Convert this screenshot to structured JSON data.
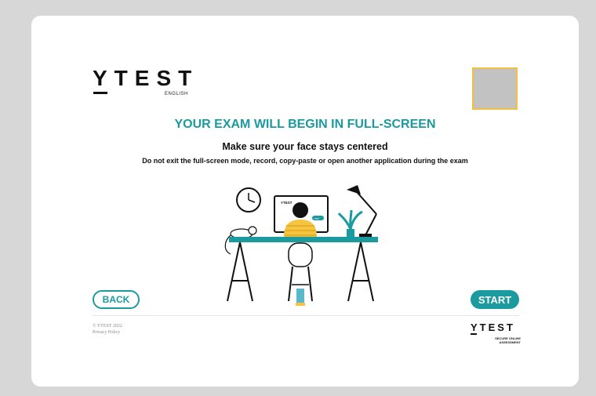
{
  "brand": {
    "name": "YTEST",
    "subtitle": "ENGLISH",
    "accent_color": "#1b9aa0",
    "underline_color": "#f0c040"
  },
  "main": {
    "headline": "YOUR EXAM WILL BEGIN IN FULL-SCREEN",
    "subheadline": "Make sure your face stays centered",
    "instructions": "Do not exit the full-screen mode, record, copy-paste or open another application during the exam"
  },
  "illustration": {
    "monitor_brand": "YTEST",
    "monitor_button": "start"
  },
  "buttons": {
    "back_label": "BACK",
    "start_label": "START"
  },
  "footer": {
    "copyright": "© YTEST 2022",
    "privacy_label": "Privacy Policy",
    "logo_name": "YTEST",
    "logo_tagline_1": "SECURE ONLINE",
    "logo_tagline_2": "ASSESSMENT"
  }
}
